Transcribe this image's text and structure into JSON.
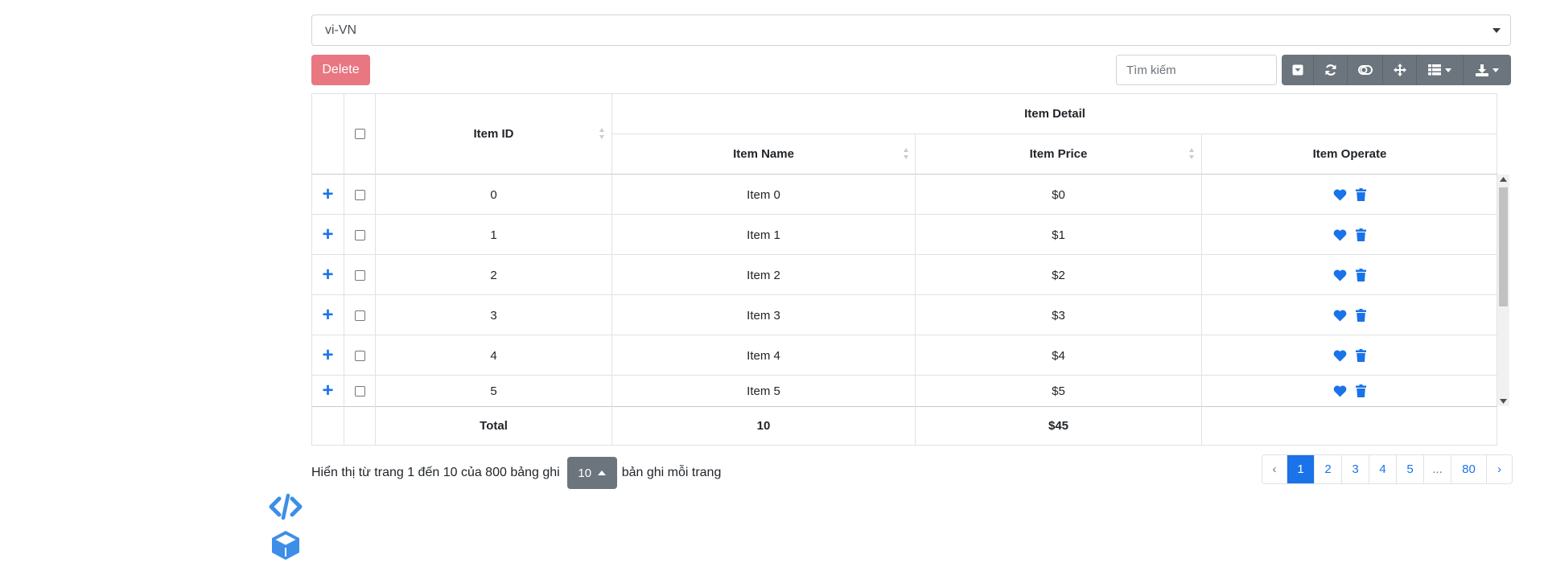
{
  "locale": {
    "value": "vi-VN"
  },
  "toolbar": {
    "delete_label": "Delete",
    "search_placeholder": "Tìm kiếm",
    "buttons": [
      "toggle-view-icon",
      "refresh-icon",
      "toggle-icon",
      "fullscreen-icon",
      "columns-icon",
      "export-icon"
    ]
  },
  "table": {
    "headers": {
      "item_id": "Item ID",
      "item_detail": "Item Detail",
      "item_name": "Item Name",
      "item_price": "Item Price",
      "item_operate": "Item Operate"
    },
    "rows": [
      {
        "id": "0",
        "name": "Item 0",
        "price": "$0"
      },
      {
        "id": "1",
        "name": "Item 1",
        "price": "$1"
      },
      {
        "id": "2",
        "name": "Item 2",
        "price": "$2"
      },
      {
        "id": "3",
        "name": "Item 3",
        "price": "$3"
      },
      {
        "id": "4",
        "name": "Item 4",
        "price": "$4"
      },
      {
        "id": "5",
        "name": "Item 5",
        "price": "$5"
      }
    ],
    "footer": {
      "label": "Total",
      "name_total": "10",
      "price_total": "$45"
    }
  },
  "pagination": {
    "info_prefix": "Hiển thị từ trang 1 đến 10 của 800 bảng ghi",
    "page_size": "10",
    "info_suffix": "bản ghi mỗi trang",
    "prev": "‹",
    "pages": [
      "1",
      "2",
      "3",
      "4",
      "5",
      "...",
      "80"
    ],
    "active_page": "1",
    "next": "›"
  },
  "colors": {
    "accent": "#1a73e8",
    "danger": "#e4606d",
    "secondary": "#6c757d"
  }
}
